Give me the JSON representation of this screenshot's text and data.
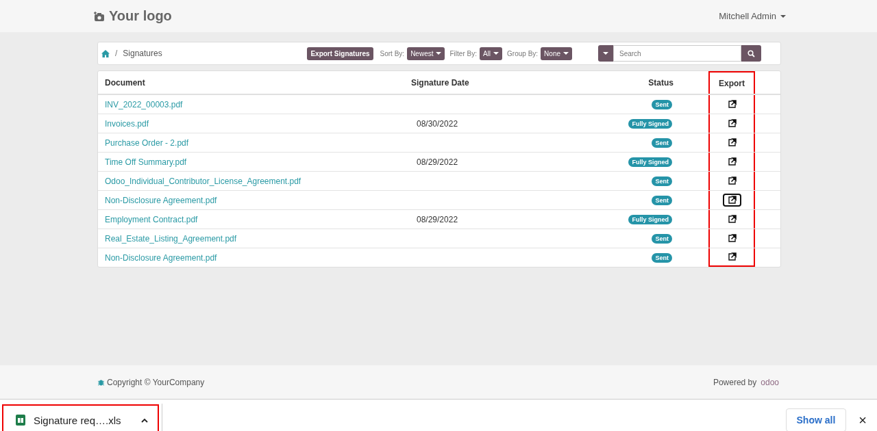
{
  "header": {
    "logo": "Your logo",
    "user": "Mitchell Admin"
  },
  "breadcrumb": {
    "separator": "/",
    "current": "Signatures"
  },
  "toolbar": {
    "export_button": "Export Signatures",
    "sort_label": "Sort By:",
    "sort_value": "Newest",
    "filter_label": "Filter By:",
    "filter_value": "All",
    "group_label": "Group By:",
    "group_value": "None",
    "search_placeholder": "Search"
  },
  "table": {
    "columns": [
      "Document",
      "Signature Date",
      "Status",
      "Export"
    ],
    "export_highlighted": true,
    "rows": [
      {
        "document": "INV_2022_00003.pdf",
        "date": "",
        "status": "Sent",
        "focused": false
      },
      {
        "document": "Invoices.pdf",
        "date": "08/30/2022",
        "status": "Fully Signed",
        "focused": false
      },
      {
        "document": "Purchase Order - 2.pdf",
        "date": "",
        "status": "Sent",
        "focused": false
      },
      {
        "document": "Time Off Summary.pdf",
        "date": "08/29/2022",
        "status": "Fully Signed",
        "focused": false
      },
      {
        "document": "Odoo_Individual_Contributor_License_Agreement.pdf",
        "date": "",
        "status": "Sent",
        "focused": false
      },
      {
        "document": "Non-Disclosure Agreement.pdf",
        "date": "",
        "status": "Sent",
        "focused": true
      },
      {
        "document": "Employment Contract.pdf",
        "date": "08/29/2022",
        "status": "Fully Signed",
        "focused": false
      },
      {
        "document": "Real_Estate_Listing_Agreement.pdf",
        "date": "",
        "status": "Sent",
        "focused": false
      },
      {
        "document": "Non-Disclosure Agreement.pdf",
        "date": "",
        "status": "Sent",
        "focused": false
      }
    ]
  },
  "footer": {
    "copyright": "Copyright © YourCompany",
    "powered_by": "Powered by",
    "brand": "odoo"
  },
  "downloads": {
    "items": [
      {
        "name": "Signature req….xls",
        "highlighted": true
      }
    ],
    "show_all": "Show all",
    "close": "×"
  }
}
